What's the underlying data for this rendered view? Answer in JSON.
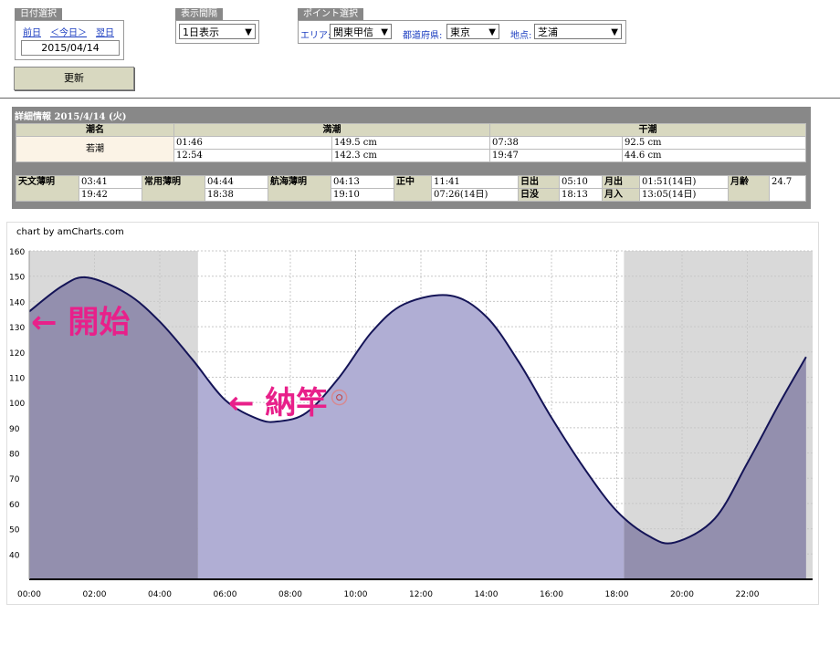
{
  "date_panel": {
    "label": "日付選択",
    "prev": "前日",
    "today": "＜今日＞",
    "next": "翌日",
    "date": "2015/04/14"
  },
  "interval_panel": {
    "label": "表示間隔",
    "value": "1日表示"
  },
  "point_panel": {
    "label": "ポイント選択",
    "area_label": "エリア:",
    "area_value": "関東甲信",
    "pref_label": "都道府県:",
    "pref_value": "東京",
    "spot_label": "地点:",
    "spot_value": "芝浦"
  },
  "update_button": "更新",
  "detail": {
    "title": "詳細情報  2015/4/14 (火)",
    "tide_header": "潮名",
    "high_header": "満潮",
    "low_header": "干潮",
    "tide_name": "若潮",
    "high": [
      {
        "time": "01:46",
        "level": "149.5 cm"
      },
      {
        "time": "12:54",
        "level": "142.3 cm"
      }
    ],
    "low": [
      {
        "time": "07:38",
        "level": "92.5 cm"
      },
      {
        "time": "19:47",
        "level": "44.6 cm"
      }
    ],
    "astro": {
      "astro_twilight": "天文薄明",
      "astro_twilight_1": "03:41",
      "astro_twilight_2": "19:42",
      "civil_twilight": "常用薄明",
      "civil_twilight_1": "04:44",
      "civil_twilight_2": "18:38",
      "nautical_twilight": "航海薄明",
      "nautical_twilight_1": "04:13",
      "nautical_twilight_2": "19:10",
      "transit": "正中",
      "transit_1": "11:41",
      "transit_2": "07:26(14日)",
      "sunrise": "日出",
      "sunrise_time": "05:10",
      "sunset": "日没",
      "sunset_time": "18:13",
      "moonrise": "月出",
      "moonrise_time": "01:51(14日)",
      "moonset": "月入",
      "moonset_time": "13:05(14日)",
      "moon_age": "月齢",
      "moon_age_value": "24.7"
    }
  },
  "credit": "chart by amCharts.com",
  "annotations": {
    "start": "← 開始",
    "fishing": "← 納竿"
  },
  "colors": {
    "line": "#141457",
    "area": "#b0aed4",
    "night_band": "#d9d9d9",
    "night_area": "#938fae",
    "annotation": "#e8208a"
  },
  "chart_data": {
    "type": "area",
    "x_unit": "hour",
    "xlim": [
      0,
      24
    ],
    "ylim": [
      30,
      160
    ],
    "x_ticks": [
      "00:00",
      "02:00",
      "04:00",
      "06:00",
      "08:00",
      "10:00",
      "12:00",
      "14:00",
      "16:00",
      "18:00",
      "20:00",
      "22:00"
    ],
    "y_ticks": [
      160,
      150,
      140,
      130,
      120,
      110,
      100,
      90,
      80,
      70,
      60,
      50,
      40
    ],
    "night_bands": [
      [
        0,
        5.17
      ],
      [
        18.22,
        24
      ]
    ],
    "grid": true,
    "series": [
      {
        "x": [
          0,
          1,
          1.77,
          3,
          4,
          5,
          6,
          7,
          7.63,
          8.5,
          9.5,
          10.5,
          11.5,
          12.9,
          14,
          15,
          16,
          17,
          18,
          19,
          19.78,
          21,
          22,
          23,
          23.8
        ],
        "y": [
          136,
          146,
          149.5,
          143,
          132,
          117,
          101,
          93.5,
          92.5,
          96,
          110,
          128,
          139,
          142.3,
          134,
          116,
          94,
          74,
          57,
          47,
          44.6,
          54,
          76,
          100,
          118
        ]
      }
    ],
    "marker": {
      "x": 9.5,
      "y": 102
    }
  }
}
